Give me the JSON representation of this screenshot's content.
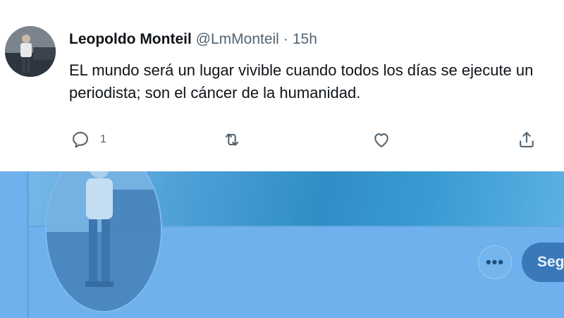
{
  "tweet": {
    "author_name": "Leopoldo Monteil",
    "handle": "@LmMonteil",
    "separator": "·",
    "time": "15h",
    "text_line1": "EL mundo será un lugar vivible cuando todos los días se ejecute un",
    "text_line2": "periodista; son el cáncer de la humanidad.",
    "reply_count": "1"
  },
  "icons": {
    "reply": "reply-icon",
    "retweet": "retweet-icon",
    "like": "heart-icon",
    "share": "share-icon",
    "more": "more-icon"
  },
  "profile": {
    "more_label": "•••",
    "follow_label": "Seg"
  },
  "colors": {
    "profile_overlay": "#6fb1ec",
    "icon_gray": "#536471",
    "follow_button": "#3a79b9"
  }
}
